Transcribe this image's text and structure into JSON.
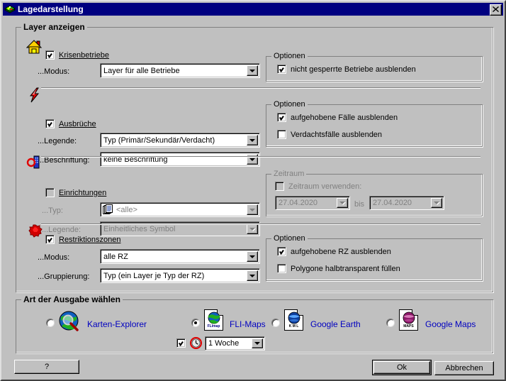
{
  "window": {
    "title": "Lagedarstellung",
    "title_icon": "map-layers-icon",
    "close_label": "✕",
    "titlebar_color": "#000080"
  },
  "layers_group": {
    "title": "Layer anzeigen",
    "sections": [
      {
        "id": "krisenbetriebe",
        "icon": "house-icon",
        "checkbox_label": "Krisenbetriebe",
        "checked": true,
        "enabled": true,
        "fields": [
          {
            "label": "...Modus:",
            "value": "Layer für alle Betriebe"
          }
        ],
        "options": {
          "title": "Optionen",
          "items": [
            {
              "label": "nicht gesperrte Betriebe ausblenden",
              "checked": true
            }
          ]
        }
      },
      {
        "id": "ausbrueche",
        "icon": "lightning-bolt-icon",
        "checkbox_label": "Ausbrüche",
        "checked": true,
        "enabled": true,
        "fields": [
          {
            "label": "...Legende:",
            "value": "Typ (Primär/Sekundär/Verdacht)"
          },
          {
            "label": "...Beschriftung:",
            "value": "keine Beschriftung"
          }
        ],
        "options": {
          "title": "Optionen",
          "items": [
            {
              "label": "aufgehobene Fälle ausblenden",
              "checked": true
            },
            {
              "label": "Verdachtsfälle ausblenden",
              "checked": false
            }
          ]
        }
      },
      {
        "id": "einrichtungen",
        "icon": "facility-icon",
        "checkbox_label": "Einrichtungen",
        "checked": false,
        "enabled": false,
        "fields": [
          {
            "label": "...Typ:",
            "value": "<alle>",
            "icon": "documents-icon"
          },
          {
            "label": "...Legende:",
            "value": "Einheitliches Symbol"
          }
        ],
        "timeframe": {
          "title": "Zeitraum",
          "checkbox_label": "Zeitraum verwenden:",
          "checked": false,
          "from": "27.04.2020",
          "separator": "bis",
          "to": "27.04.2020"
        }
      },
      {
        "id": "restriktionszonen",
        "icon": "red-blob-icon",
        "checkbox_label": "Restriktionszonen",
        "checked": true,
        "enabled": true,
        "fields": [
          {
            "label": "...Modus:",
            "value": "alle RZ"
          },
          {
            "label": "...Gruppierung:",
            "value": "Typ  (ein Layer je Typ der RZ)"
          }
        ],
        "options": {
          "title": "Optionen",
          "items": [
            {
              "label": "aufgehobene RZ ausblenden",
              "checked": true
            },
            {
              "label": "Polygone halbtransparent füllen",
              "checked": false
            }
          ]
        }
      }
    ]
  },
  "output_group": {
    "title": "Art der Ausgabe wählen",
    "options": [
      {
        "id": "karten-explorer",
        "label": "Karten-Explorer",
        "icon": "globe-magnifier-icon",
        "selected": false
      },
      {
        "id": "fli-maps",
        "label": "FLI-Maps",
        "icon": "flimap-file-icon",
        "tag": "FLImap",
        "selected": true
      },
      {
        "id": "google-earth",
        "label": "Google Earth",
        "icon": "kml-file-icon",
        "tag": "K M L",
        "selected": false
      },
      {
        "id": "google-maps",
        "label": "Google Maps",
        "icon": "maps-file-icon",
        "tag": "MAPS",
        "selected": false
      }
    ],
    "duration": {
      "checked": true,
      "icon": "clock-icon",
      "value": "1 Woche"
    },
    "label_color": "#0000c0"
  },
  "footer": {
    "help_label": "?",
    "ok_label": "Ok",
    "cancel_label": "Abbrechen"
  }
}
